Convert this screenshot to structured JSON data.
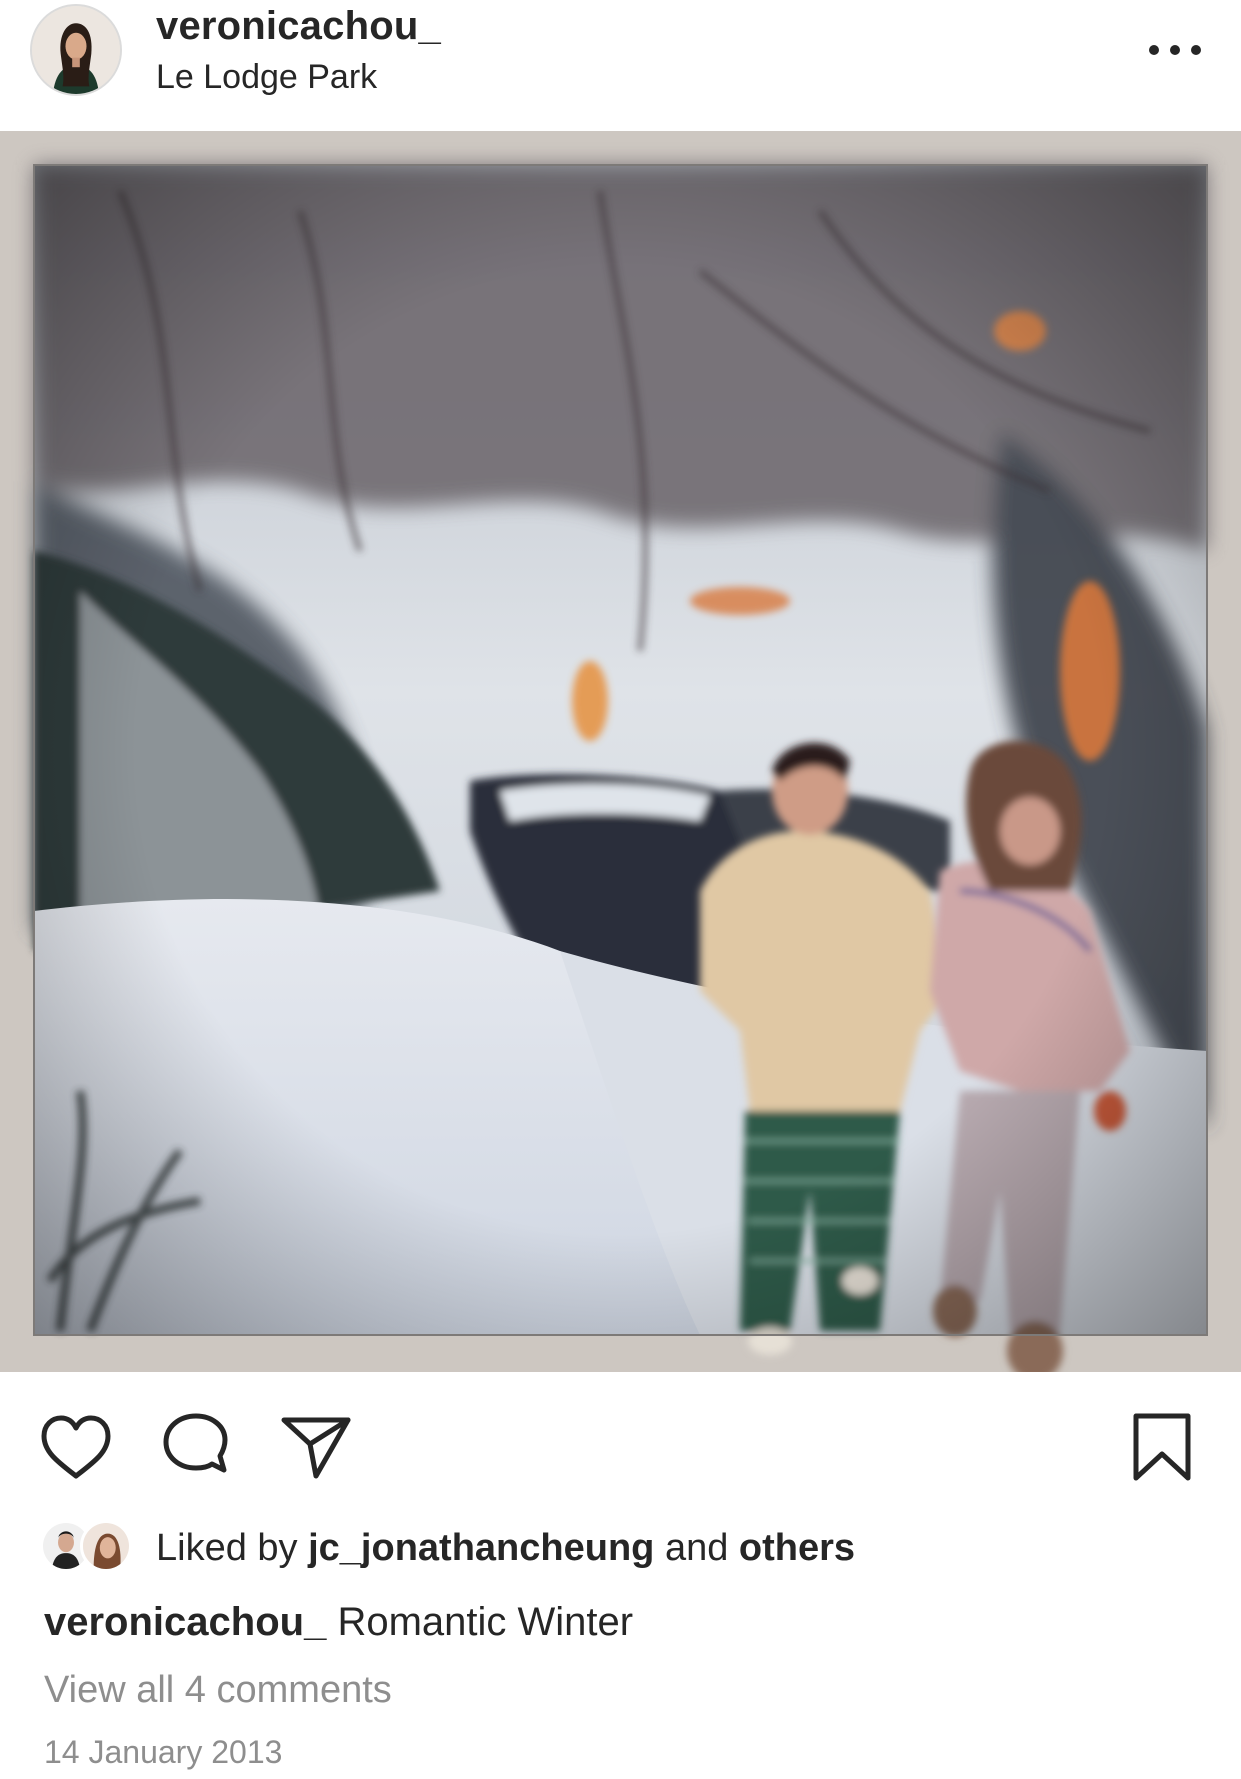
{
  "post": {
    "username": "veronicachou_",
    "location": "Le Lodge Park",
    "more_icon": "ellipsis-horizontal-icon",
    "photo_description_icon": "photo",
    "likes": {
      "prefix": "Liked by",
      "first_user": "jc_jonathancheung",
      "conjunction": "and",
      "others": "others"
    },
    "caption": {
      "username": "veronicachou_",
      "text": "Romantic Winter"
    },
    "view_comments": "View all 4 comments",
    "date": "14 January 2013"
  },
  "icons": {
    "like": "heart-icon",
    "comment": "comment-bubble-icon",
    "share": "paper-plane-icon",
    "save": "bookmark-icon"
  },
  "colors": {
    "text_primary": "#262626",
    "text_secondary": "#8e8e8e",
    "frame": "#c9c3bd"
  }
}
